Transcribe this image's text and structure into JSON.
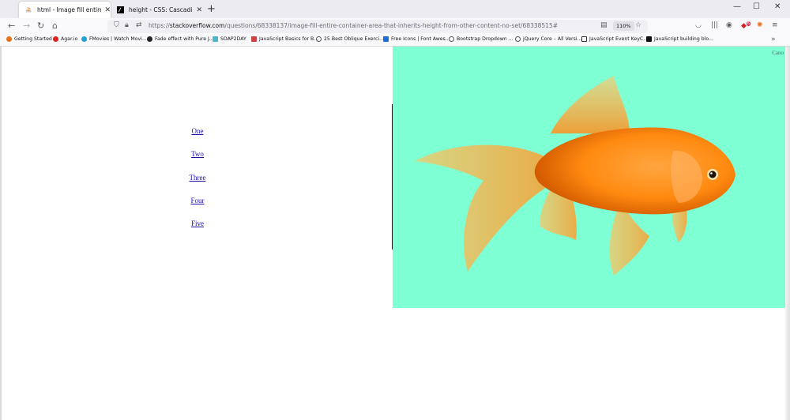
{
  "tabs": [
    {
      "title": "html - Image fill entire container"
    },
    {
      "title": "height - CSS: Cascading Style Sheets"
    }
  ],
  "window_controls": {
    "minimize": "—",
    "maximize": "☐",
    "close": "✕"
  },
  "toolbar": {
    "url_prefix": "https://",
    "url_host": "stackoverflow.com",
    "url_path": "/questions/68338137/image-fill-entire-container-area-that-inherits-height-from-other-content-no-set/68338515#",
    "zoom": "110%",
    "notification_badge": "6"
  },
  "bookmarks": [
    {
      "label": "Getting Started",
      "color": "#e8711c"
    },
    {
      "label": "Agar.io",
      "color": "#e02020"
    },
    {
      "label": "FMovies | Watch Movi...",
      "color": "#1fa3d6"
    },
    {
      "label": "Fade effect with Pure J...",
      "color": "#222222"
    },
    {
      "label": "SOAP2DAY",
      "color": "#4ab8c8"
    },
    {
      "label": "JavaScript Basics for B...",
      "color": "#c44"
    },
    {
      "label": "25 Best Oblique Exerci...",
      "color": "#555555"
    },
    {
      "label": "Free Icons | Font Awes...",
      "color": "#1c6fd6"
    },
    {
      "label": "Bootstrap Dropdown ...",
      "color": "#555555"
    },
    {
      "label": "jQuery Core – All Versi...",
      "color": "#555555"
    },
    {
      "label": "JavaScript Event KeyC...",
      "color": "#333333"
    },
    {
      "label": "JavaScript building blo...",
      "color": "#111111"
    }
  ],
  "content": {
    "links": [
      "One",
      "Two",
      "Three",
      "Four",
      "Five"
    ],
    "image_caption": "Cano",
    "image_background": "#7fffd4"
  }
}
